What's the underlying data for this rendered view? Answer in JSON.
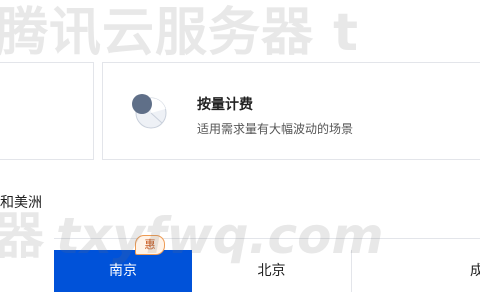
{
  "billing": {
    "payg": {
      "title": "按量计费",
      "description": "适用需求量有大幅波动的场景",
      "icon": "pie-chart-icon"
    }
  },
  "regions": {
    "group_label": "和美洲",
    "tabs": [
      {
        "label": "南京",
        "selected": true,
        "badge": "惠"
      },
      {
        "label": "北京",
        "selected": false
      },
      {
        "label": "成",
        "selected": false
      }
    ]
  },
  "watermark": {
    "top": "腾讯云服务器 t",
    "bottom_cn": "器",
    "bottom_url": "txyfwq.com"
  },
  "colors": {
    "accent": "#0052d9",
    "badge": "#ee9b54"
  }
}
